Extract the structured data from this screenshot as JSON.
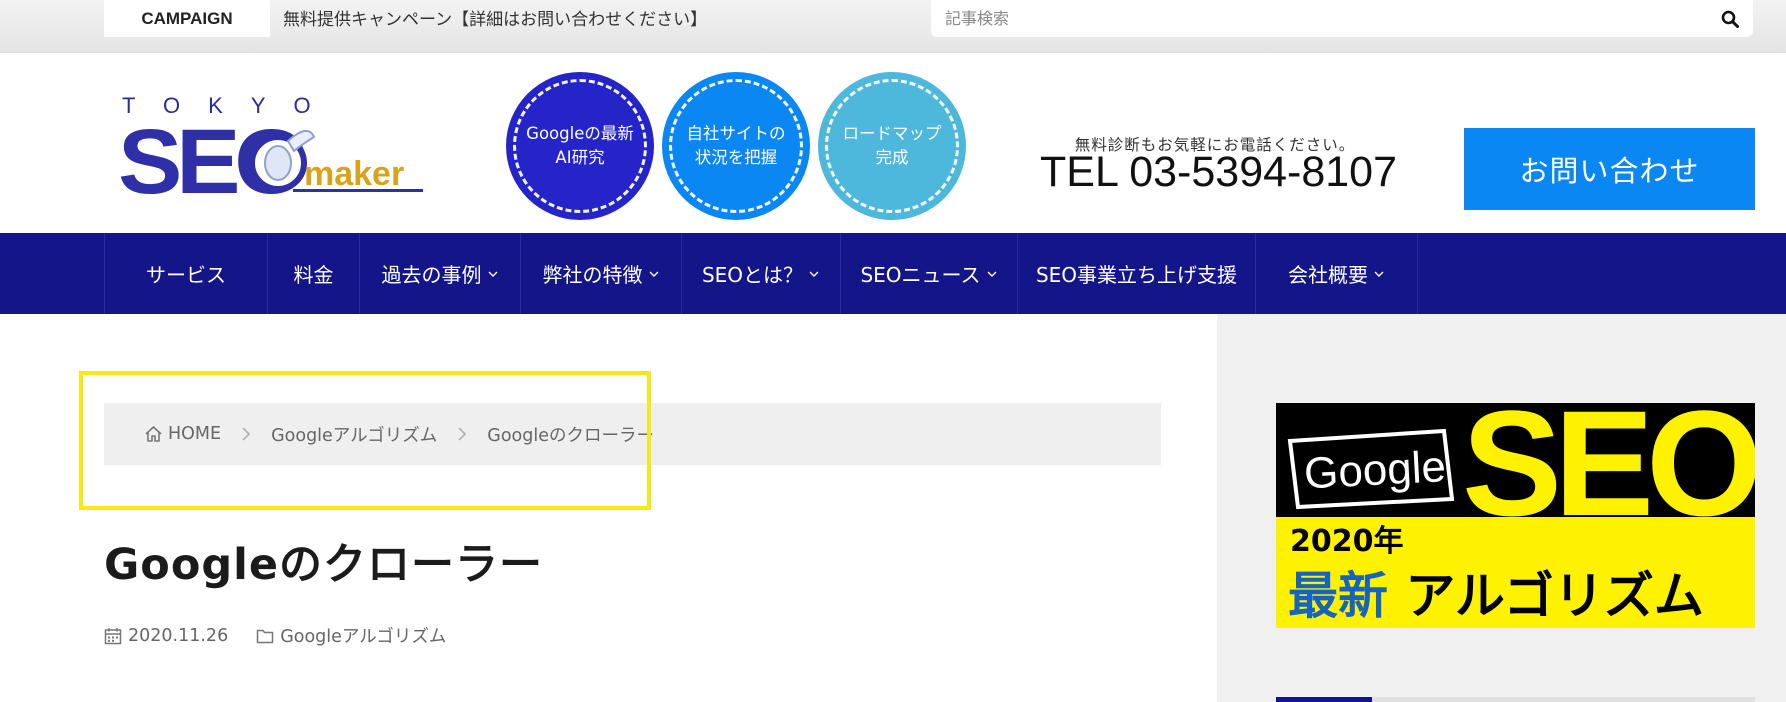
{
  "topbar": {
    "campaign_label": "CAMPAIGN",
    "campaign_text": "無料提供キャンペーン【詳細はお問い合わせください】",
    "search_placeholder": "記事検索"
  },
  "header": {
    "logo": {
      "top_text": "TOKYO",
      "main_text": "SEO",
      "sub_text": "maker"
    },
    "circles": [
      {
        "label": "Googleの最新\nAI研究"
      },
      {
        "label": "自社サイトの\n状況を把握"
      },
      {
        "label": "ロードマップ\n完成"
      }
    ],
    "tel_note": "無料診断もお気軽にお電話ください。",
    "tel": "TEL 03-5394-8107",
    "contact_label": "お問い合わせ"
  },
  "nav": {
    "items": [
      {
        "label": "サービス",
        "dropdown": false
      },
      {
        "label": "料金",
        "dropdown": false
      },
      {
        "label": "過去の事例",
        "dropdown": true
      },
      {
        "label": "弊社の特徴",
        "dropdown": true
      },
      {
        "label": "SEOとは？",
        "dropdown": true
      },
      {
        "label": "SEOニュース",
        "dropdown": true
      },
      {
        "label": "SEO事業立ち上げ支援",
        "dropdown": false
      },
      {
        "label": "会社概要",
        "dropdown": true
      }
    ]
  },
  "breadcrumb": {
    "items": [
      "HOME",
      "Googleアルゴリズム",
      "Googleのクローラー"
    ]
  },
  "article": {
    "title": "Googleのクローラー",
    "date": "2020.11.26",
    "category": "Googleアルゴリズム"
  },
  "sidebar": {
    "banner": {
      "brand": "Google",
      "big": "SEO",
      "year": "2020年",
      "accent": "最新",
      "rest": "アルゴリズム"
    }
  },
  "colors": {
    "nav_bg": "#15158a",
    "brand_blue": "#0a87f3",
    "circle_1": "#2424c8",
    "circle_3": "#4db8dc",
    "highlight": "#f7ea14",
    "banner_yellow": "#fff200"
  }
}
